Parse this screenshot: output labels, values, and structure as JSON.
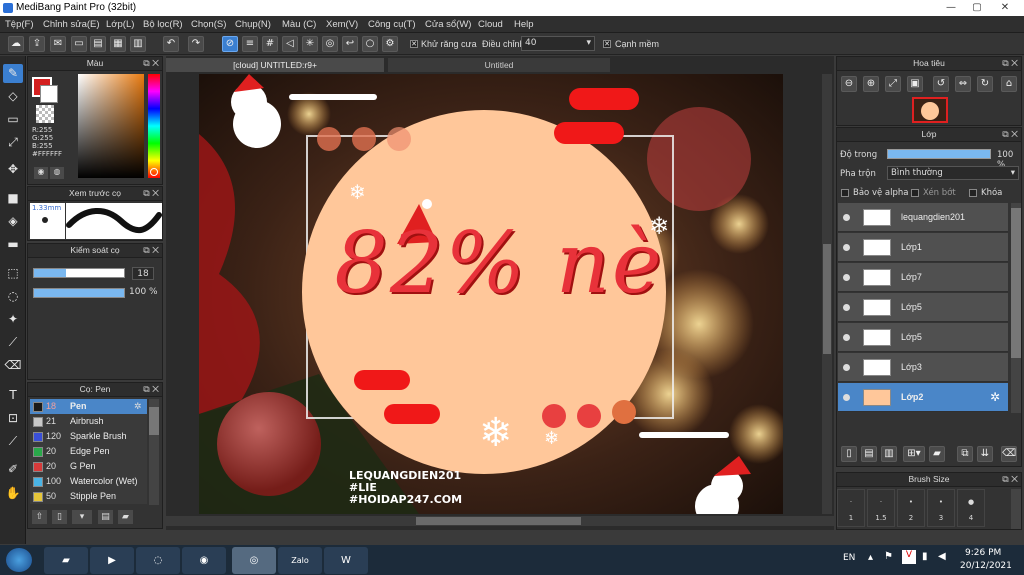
{
  "titlebar": {
    "title": "MediBang Paint Pro (32bit)",
    "minimize": "—",
    "maximize": "▢",
    "close": "✕"
  },
  "menu": [
    "Tệp(F)",
    "Chỉnh sửa(E)",
    "Lớp(L)",
    "Bộ lọc(R)",
    "Chọn(S)",
    "Chụp(N)",
    "Màu (C)",
    "Xem(V)",
    "Công cụ(T)",
    "Cửa sổ(W)",
    "Cloud",
    "Help"
  ],
  "toolbar": {
    "antialias_label": "Khử răng cưa",
    "adjust_label": "Điều chỉnh",
    "adjust_value": "40",
    "sharp_label": "Cạnh mềm",
    "antialias_checked": "✕",
    "sharp_checked": "✕"
  },
  "color_panel": {
    "title": "Màu",
    "rgb_r": "R:255",
    "rgb_g": "G:255",
    "rgb_b": "B:255",
    "hex": "#FFFFFF"
  },
  "brush_preview": {
    "title": "Xem trước cọ",
    "size_label": "1.33mm"
  },
  "brush_control": {
    "title": "Kiểm soát cọ",
    "size_value": "18",
    "opacity_value": "100 %"
  },
  "brush_panel": {
    "title": "Cọ: Pen",
    "items": [
      {
        "size": "18",
        "name": "Pen",
        "color": "#1a1a1a"
      },
      {
        "size": "21",
        "name": "Airbrush",
        "color": "#c8c8c8"
      },
      {
        "size": "120",
        "name": "Sparkle Brush",
        "color": "#3a4fd6"
      },
      {
        "size": "20",
        "name": "Edge Pen",
        "color": "#2aa84a"
      },
      {
        "size": "20",
        "name": "G Pen",
        "color": "#d63a3a"
      },
      {
        "size": "100",
        "name": "Watercolor (Wet)",
        "color": "#4ab4e6"
      },
      {
        "size": "50",
        "name": "Stipple Pen",
        "color": "#e6c63a"
      }
    ]
  },
  "doc_tabs": {
    "tab1": "[cloud] UNTITLED:r9+",
    "tab2": "Untitled"
  },
  "artwork": {
    "main_text": "82% nè",
    "watermark_line1": "LEQUANGDIEN201",
    "watermark_line2": "#LIE",
    "watermark_line3": "#HOIDAP247.COM"
  },
  "navigator": {
    "title": "Hoa tiêu"
  },
  "layer_panel": {
    "title": "Lớp",
    "opacity_label": "Độ trong",
    "opacity_value": "100 %",
    "blend_label": "Pha trộn",
    "blend_value": "Bình thường",
    "protect_alpha": "Bảo vệ alpha",
    "clipping": "Xén bớt",
    "lock": "Khóa",
    "layers": [
      {
        "name": "lequangdien201"
      },
      {
        "name": "Lớp1"
      },
      {
        "name": "Lớp7"
      },
      {
        "name": "Lớp5"
      },
      {
        "name": "Lớp5"
      },
      {
        "name": "Lớp3"
      },
      {
        "name": "Lớp2"
      }
    ]
  },
  "brush_size_panel": {
    "title": "Brush Size",
    "sizes": [
      "1",
      "1.5",
      "2",
      "3",
      "4"
    ]
  },
  "taskbar": {
    "lang": "EN",
    "time": "9:26 PM",
    "date": "20/12/2021",
    "zalo_label": "Zalo"
  }
}
